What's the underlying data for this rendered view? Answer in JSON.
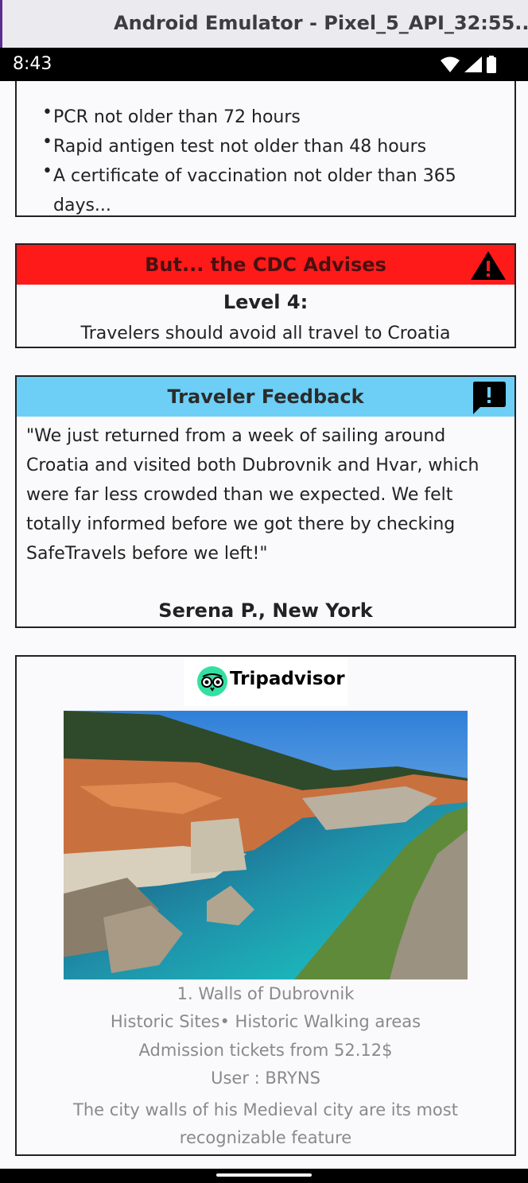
{
  "window": {
    "title": "Android Emulator - Pixel_5_API_32:55..."
  },
  "status_bar": {
    "time": "8:43",
    "icons": [
      "wifi-icon",
      "signal-icon",
      "battery-icon"
    ]
  },
  "requirements": {
    "items": [
      "PCR not older than 72 hours",
      "Rapid antigen test not older than 48 hours",
      "A certificate of vaccination not older than 365 days..."
    ]
  },
  "cdc": {
    "header": "But... the CDC Advises",
    "level": "Level 4:",
    "text": "Travelers should avoid all travel to Croatia",
    "header_color": "#ff1a1a"
  },
  "feedback": {
    "header": "Traveler Feedback",
    "quote": " \"We just returned from a week of sailing around Croatia and visited both Dubrovnik and Hvar, which were far less crowded than we expected. We felt totally informed before we got there by checking SafeTravels before we left!\"",
    "author": "Serena P., New York",
    "header_color": "#6dcff6"
  },
  "tripadvisor": {
    "logo_text": "Tripadvisor",
    "title": "1. Walls of Dubrovnik",
    "category": "Historic Sites• Historic Walking areas",
    "price": "Admission tickets from 52.12$",
    "user": "User : BRYNS",
    "description": "The city walls of his Medieval city are its most recognizable feature"
  }
}
